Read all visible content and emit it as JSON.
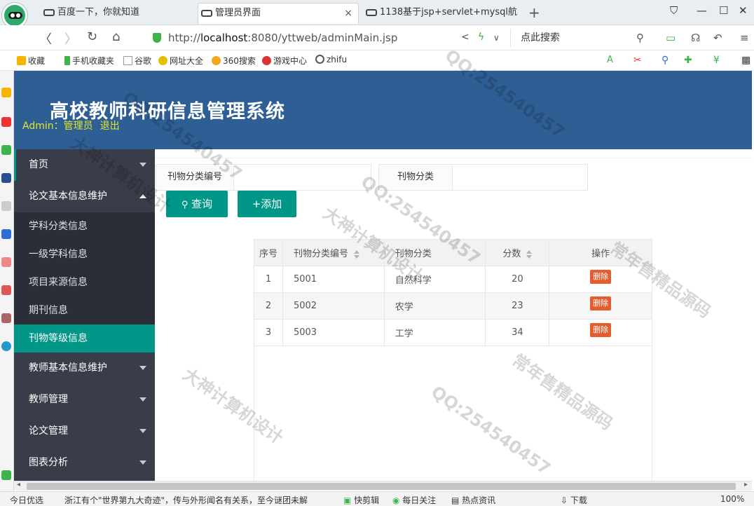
{
  "browser": {
    "tabs": [
      {
        "label": "百度一下，你就知道",
        "active": false
      },
      {
        "label": "管理员界面",
        "active": true
      },
      {
        "label": "1138基于jsp+servlet+mysql航",
        "active": false
      }
    ],
    "new_tab": "+",
    "close": "×",
    "url_prefix": "http://",
    "url_host": "localhost",
    "url_rest": ":8080/yttweb/adminMain.jsp",
    "search_placeholder": "点此搜索",
    "bookmarks": [
      "收藏",
      "手机收藏夹",
      "谷歌",
      "网址大全",
      "360搜索",
      "游戏中心",
      "zhifu"
    ]
  },
  "app": {
    "title": "高校教师科研信息管理系统",
    "admin_label": "Admin：管理员",
    "logout": "退出"
  },
  "sidebar": {
    "items": [
      {
        "label": "首页"
      },
      {
        "label": "论文基本信息维护"
      },
      {
        "label": "教师基本信息维护"
      },
      {
        "label": "教师管理"
      },
      {
        "label": "论文管理"
      },
      {
        "label": "图表分析"
      }
    ],
    "subitems": [
      {
        "label": "学科分类信息"
      },
      {
        "label": "一级学科信息"
      },
      {
        "label": "项目来源信息"
      },
      {
        "label": "期刊信息"
      },
      {
        "label": "刊物等级信息",
        "active": true
      }
    ]
  },
  "search": {
    "field1_label": "刊物分类编号",
    "field1_value": "",
    "field2_label": "刊物分类",
    "field2_value": "",
    "query_button": "查询",
    "add_button": "+添加"
  },
  "table": {
    "headers": [
      "序号",
      "刊物分类编号",
      "刊物分类",
      "分数",
      "操作"
    ],
    "rows": [
      {
        "idx": "1",
        "code": "5001",
        "category": "自然科学",
        "score": "20",
        "action": "删除"
      },
      {
        "idx": "2",
        "code": "5002",
        "category": "农学",
        "score": "23",
        "action": "删除"
      },
      {
        "idx": "3",
        "code": "5003",
        "category": "工学",
        "score": "34",
        "action": "删除"
      }
    ]
  },
  "statusbar": {
    "left": "今日优选",
    "news": "浙江有个\"世界第九大奇迹\"，传与外形闻名有关系，至今谜团未解",
    "items": [
      "快剪辑",
      "每日关注",
      "热点资讯",
      "下载"
    ],
    "zoom": "100%"
  },
  "watermarks": [
    "大神计算机设计",
    "QQ:254540457",
    "常年售精品源码"
  ]
}
